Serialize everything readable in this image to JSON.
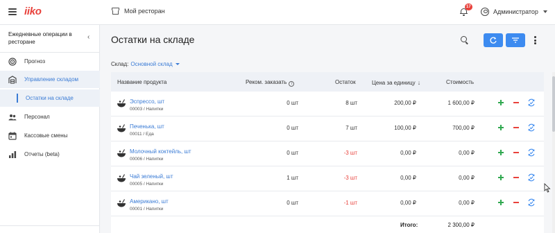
{
  "topbar": {
    "logo": "iiko",
    "restaurant": "Мой ресторан",
    "notifications_count": "17",
    "user": "Администратор"
  },
  "sidebar": {
    "heading": "Ежедневные операции в ресторане",
    "collapse_glyph": "‹",
    "items": [
      {
        "label": "Прогноз",
        "icon": "target-icon"
      },
      {
        "label": "Управление складом",
        "icon": "warehouse-icon",
        "active": true
      },
      {
        "label": "Остатки на складе",
        "sub": true,
        "active": true
      },
      {
        "label": "Персонал",
        "icon": "people-icon"
      },
      {
        "label": "Кассовые смены",
        "icon": "calendar-icon"
      },
      {
        "label": "Отчеты (beta)",
        "icon": "bar-chart-icon"
      }
    ]
  },
  "page": {
    "title": "Остатки на складе",
    "warehouse_label": "Склад:",
    "warehouse_value": "Основной склад"
  },
  "table": {
    "columns": {
      "name": "Название продукта",
      "recommended": "Реком. заказать",
      "remaining": "Остаток",
      "unit_price": "Цена за единицу",
      "cost": "Стоимость"
    },
    "info_glyph": "i",
    "sort_glyph": "↓",
    "rows": [
      {
        "name": "Эспрессо, шт",
        "meta": "00003 / Напитки",
        "recommended": "0 шт",
        "remaining": "8 шт",
        "remaining_negative": false,
        "price": "200,00 ₽",
        "cost": "1 600,00 ₽"
      },
      {
        "name": "Печенька, шт",
        "meta": "00011 / Еда",
        "recommended": "0 шт",
        "remaining": "7 шт",
        "remaining_negative": false,
        "price": "100,00 ₽",
        "cost": "700,00 ₽"
      },
      {
        "name": "Молочный коктейль, шт",
        "meta": "00006 / Напитки",
        "recommended": "0 шт",
        "remaining": "-3 шт",
        "remaining_negative": true,
        "price": "0,00 ₽",
        "cost": "0,00 ₽"
      },
      {
        "name": "Чай зеленый, шт",
        "meta": "00005 / Напитки",
        "recommended": "1 шт",
        "remaining": "-3 шт",
        "remaining_negative": true,
        "price": "0,00 ₽",
        "cost": "0,00 ₽"
      },
      {
        "name": "Американо, шт",
        "meta": "00001 / Напитки",
        "recommended": "0 шт",
        "remaining": "-1 шт",
        "remaining_negative": true,
        "price": "0,00 ₽",
        "cost": "0,00 ₽"
      }
    ],
    "total_label": "Итого:",
    "total_value": "2 300,00 ₽"
  },
  "colors": {
    "accent": "#3a7bd5",
    "brand": "#e8413b",
    "positive": "#2fa84f",
    "negative": "#e8413b"
  }
}
